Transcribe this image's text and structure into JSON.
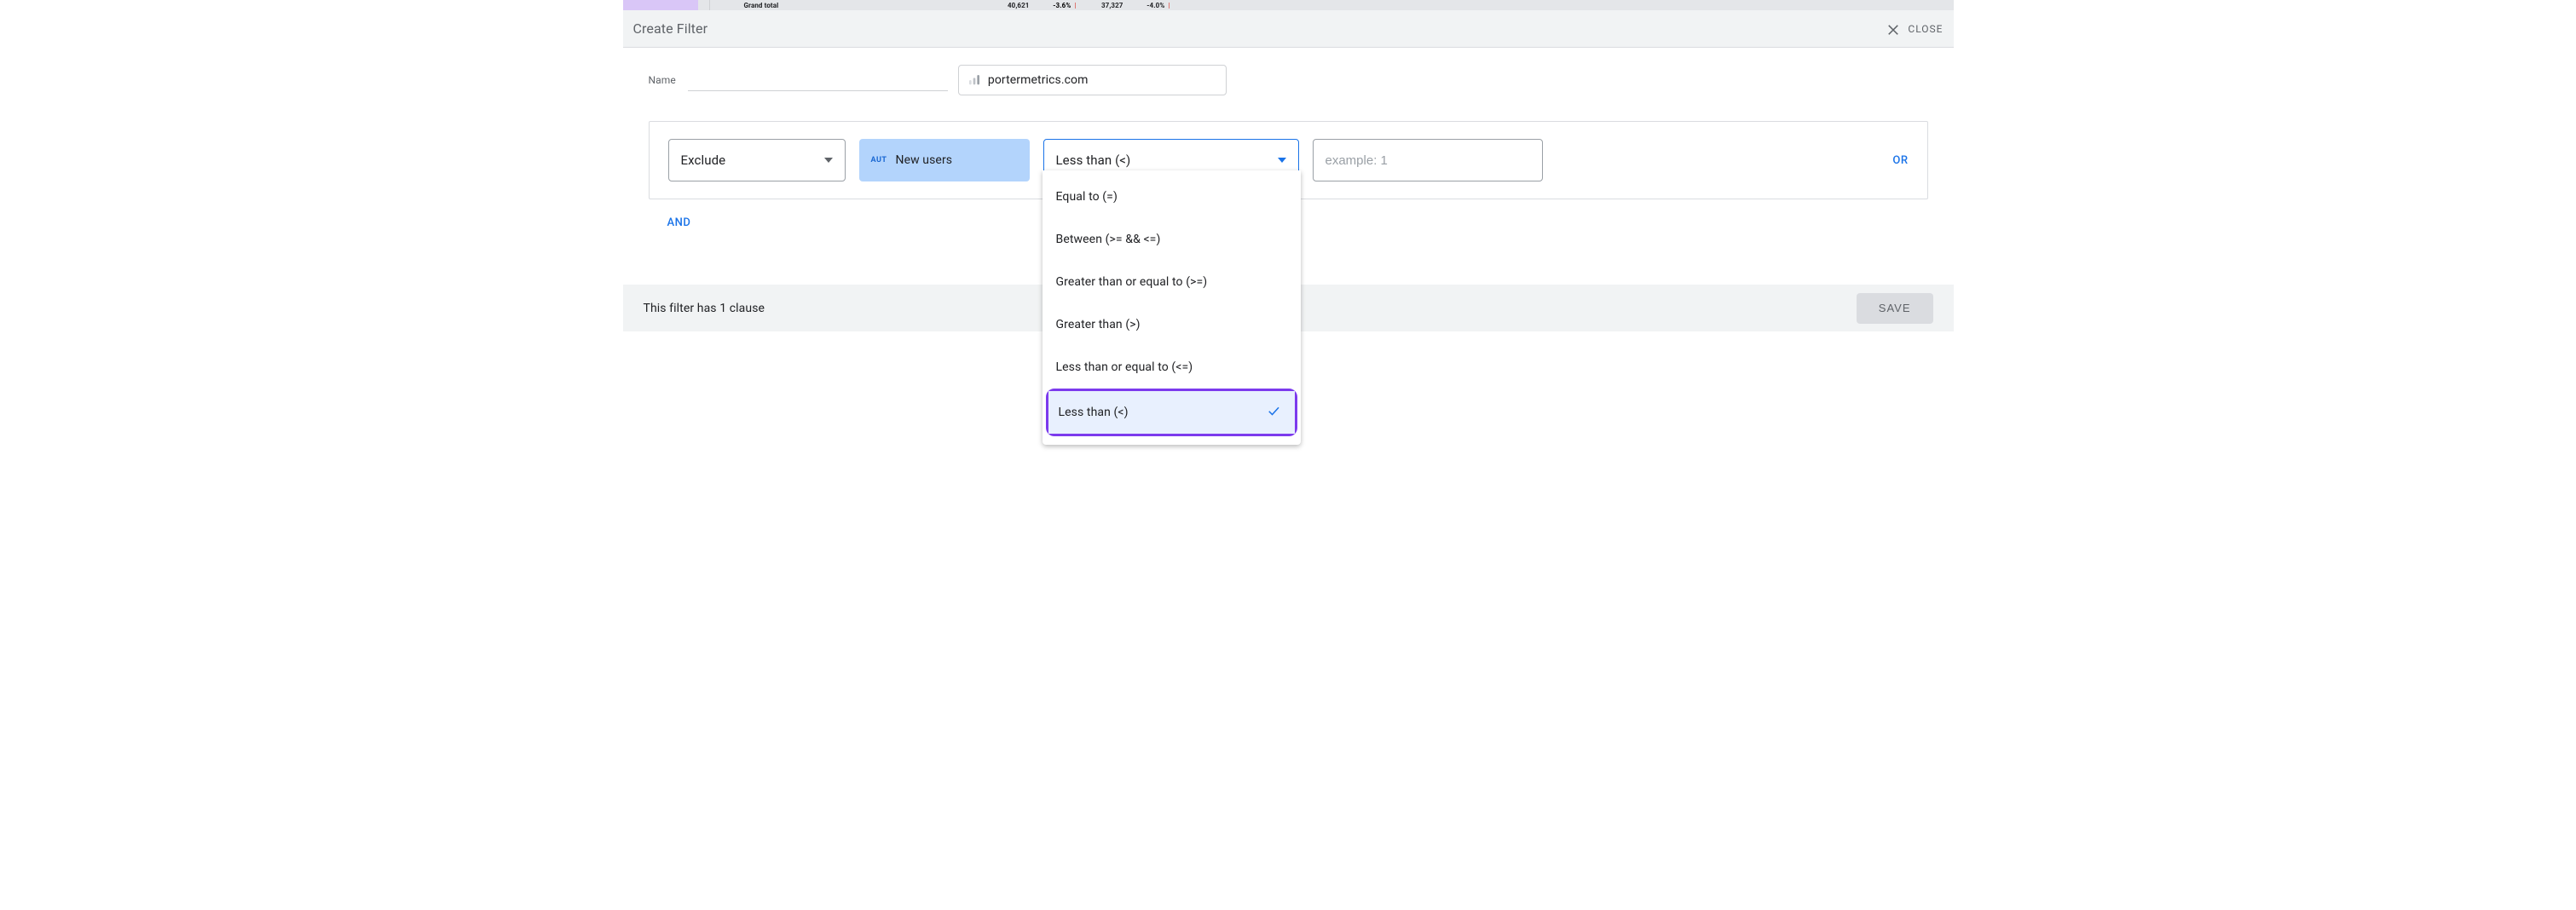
{
  "background": {
    "total_label": "Grand total",
    "value1": "40,621",
    "delta1": "-3.6%",
    "value2": "37,327",
    "delta2": "-4.0%"
  },
  "header": {
    "title": "Create Filter",
    "close_label": "CLOSE"
  },
  "form": {
    "name_label": "Name",
    "name_value": "",
    "source": "portermetrics.com"
  },
  "clause": {
    "mode": "Exclude",
    "metric_type": "AUT",
    "metric": "New users",
    "condition": "Less than (<)",
    "value_placeholder": "example: 1",
    "or_label": "OR",
    "and_label": "AND"
  },
  "dropdown": {
    "options": [
      "Equal to (=)",
      "Between (>= && <=)",
      "Greater than or equal to (>=)",
      "Greater than (>)",
      "Less than or equal to (<=)",
      "Less than (<)"
    ],
    "selected_index": 5
  },
  "footer": {
    "status": "This filter has 1 clause",
    "save_label": "SAVE"
  }
}
